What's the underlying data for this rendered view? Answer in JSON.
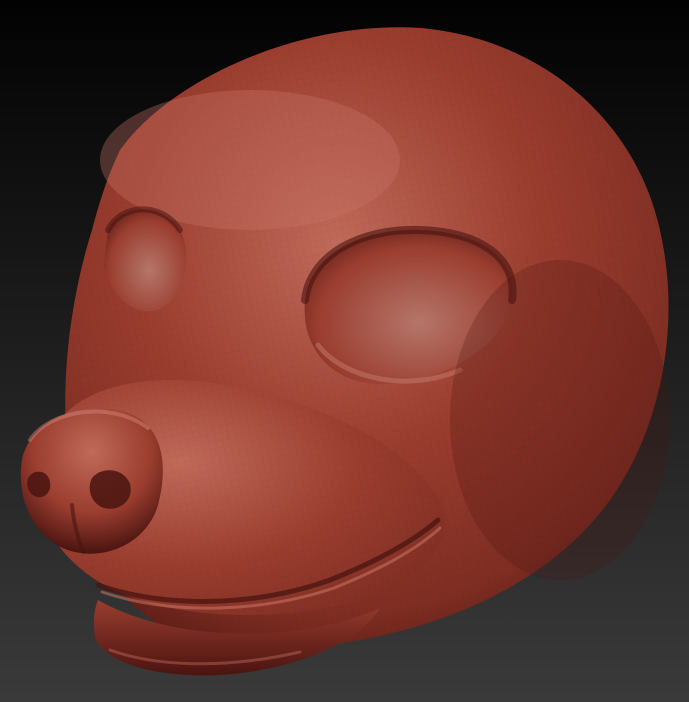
{
  "scene": {
    "subject": "sculpted-animal-head",
    "colors": {
      "background_top": "#020202",
      "background_bottom": "#3a3a3a",
      "clay_highlight": "#c06a5a",
      "clay_base": "#9a3d2f",
      "clay_mid": "#7e2d22",
      "clay_shadow": "#4a1410",
      "eye_socket_light": "#b5766a",
      "eye_socket_dark": "#5a1c15"
    }
  }
}
